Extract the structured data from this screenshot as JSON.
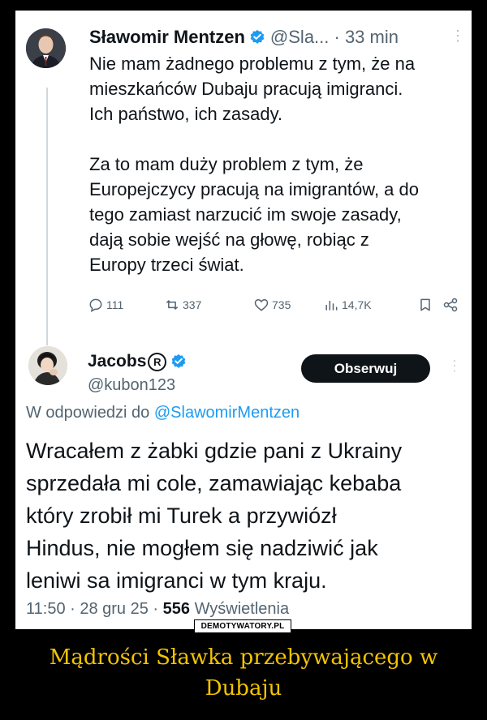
{
  "tweet1": {
    "author_name": "Sławomir Mentzen",
    "meta": "@Sla... · 33 min",
    "more_icon": "more-vertical-icon",
    "text": "Nie mam żadnego problemu z tym, że na\nmieszkańców Dubaju pracują imigranci.\nIch państwo, ich zasady.\n\nZa to mam duży problem z tym, że\nEuropejczycy pracują na imigrantów, a do\ntego zamiast narzucić im swoje zasady,\ndają sobie wejść na głowę, robiąc z\nEuropy trzeci świat.",
    "replies": "111",
    "reposts": "337",
    "likes": "735",
    "views": "14,7K"
  },
  "tweet2": {
    "author_name": "Jacobs",
    "reg_mark": "R",
    "handle": "@kubon123",
    "follow_label": "Obserwuj",
    "replying_prefix": "W odpowiedzi do",
    "replying_to": "@SlawomirMentzen",
    "text": "Wracałem z żabki gdzie pani z Ukrainy\nsprzedała mi cole, zamawiając kebaba\nktóry zrobił mi Turek a przywiózł\nHindus, nie mogłem się nadziwić jak\nleniwi sa imigranci w tym kraju.",
    "time_date": "11:50 · 28 gru 25 ·",
    "view_count": "556",
    "views_label": "Wyświetlenia"
  },
  "watermark": "DEMOTYWATORY.PL",
  "caption": "Mądrości Sławka przebywającego w\nDubaju",
  "colors": {
    "accent": "#1d9bf0",
    "caption": "#f3c400",
    "background": "#000000"
  }
}
